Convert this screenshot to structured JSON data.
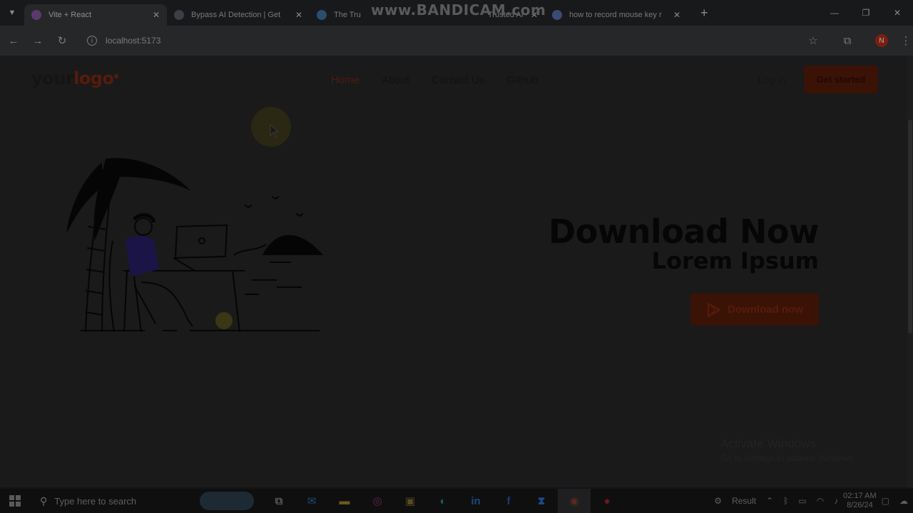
{
  "browser": {
    "tabs": [
      {
        "title": "Vite + React",
        "favicon_color": "#5b3a6b",
        "active": true
      },
      {
        "title": "Bypass AI Detection | Get",
        "favicon_color": "#3a3f46",
        "active": false
      },
      {
        "title": "The Tru",
        "favicon_color": "#2a4d70",
        "active": false
      },
      {
        "title": "Trusted AI Ch",
        "favicon_color": "#4a2b55",
        "active": false
      },
      {
        "title": "how to record mouse key r",
        "favicon_color": "#3b4b73",
        "active": false
      }
    ],
    "watermark": "www.BANDICAM.com",
    "address": "localhost:5173",
    "profile_initial": "N"
  },
  "site": {
    "logo_main": "your",
    "logo_accent": "logo",
    "nav": [
      {
        "label": "Home",
        "active": true
      },
      {
        "label": "About",
        "active": false
      },
      {
        "label": "Contact Us",
        "active": false
      },
      {
        "label": "Github",
        "active": false
      }
    ],
    "login": "Log in",
    "cta": "Get started",
    "hero_title": "Download Now",
    "hero_subtitle": "Lorem Ipsum",
    "download_button": "Download now"
  },
  "os": {
    "activate_title": "Activate Windows",
    "activate_sub": "Go to Settings to activate Windows.",
    "search_placeholder": "Type here to search",
    "tray_label": "Result",
    "time": "02:17 AM",
    "date": "8/26/24"
  },
  "colors": {
    "accent": "#571b0b",
    "page_bg": "#1a1a1a"
  }
}
